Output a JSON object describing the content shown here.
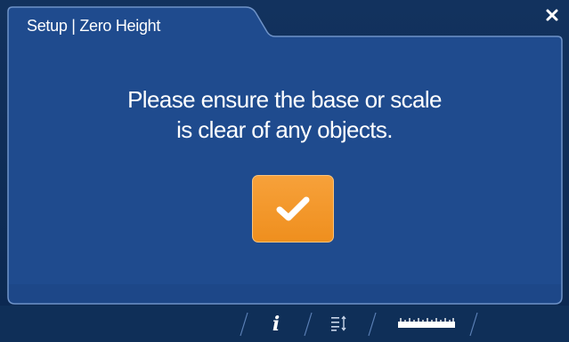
{
  "dialog": {
    "title": "Setup | Zero Height",
    "message_line1": "Please ensure the base or scale",
    "message_line2": "is clear of any objects."
  },
  "buttons": {
    "confirm_icon": "checkmark-icon",
    "close_icon": "close-icon"
  },
  "bottom_nav": {
    "items": [
      {
        "icon": "info-icon",
        "label": "i"
      },
      {
        "icon": "sort-list-icon"
      },
      {
        "icon": "ruler-icon"
      }
    ]
  },
  "colors": {
    "background": "#0d2c55",
    "panel": "#1f4b8e",
    "panel_border": "#6f93c8",
    "accent_orange": "#f39a2c",
    "text": "#ffffff"
  }
}
